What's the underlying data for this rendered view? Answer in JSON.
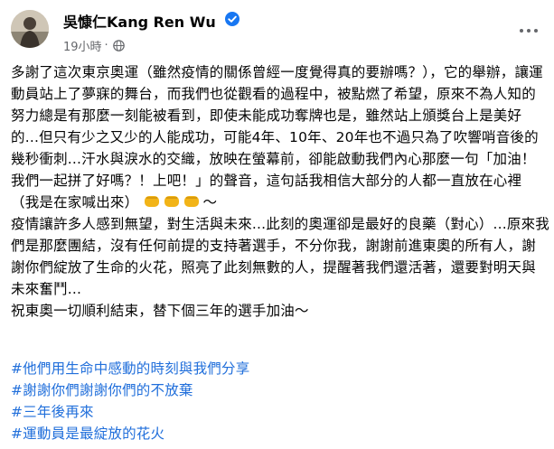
{
  "post": {
    "author": "吳慷仁Kang Ren Wu",
    "timestamp": "19小時",
    "separator": "·",
    "privacy_icon": "globe-icon",
    "verified_icon": "verified-badge-icon",
    "more_icon": "more-options-icon"
  },
  "content": {
    "p1": "多謝了這次東京奧運（雖然疫情的關係曾經一度覺得真的要辦嗎？），它的舉辦，讓運動員站上了夢寐的舞台，而我們也從觀看的過程中，被點燃了希望，原來不為人知的努力總是有那麼一刻能被看到，即使未能成功奪牌也是，雖然站上頒獎台上是美好的...但只有少之又少的人能成功，可能4年、10年、20年也不過只為了吹響哨音後的幾秒衝刺...汗水與淚水的交織，放映在螢幕前，卻能啟動我們內心那麼一句「加油！我們一起拼了好嗎？！上吧！」的聲音，這句話我相信大部分的人都一直放在心裡（我是在家喊出來）",
    "p1_tail": "～",
    "p1_emoji": "fist-emoji",
    "p2": "疫情讓許多人感到無望，對生活與未來...此刻的奧運卻是最好的良藥（對心）...原來我們是那麼團結，沒有任何前提的支持著選手，不分你我，謝謝前進東奧的所有人，謝謝你們綻放了生命的火花，照亮了此刻無數的人，提醒著我們還活著，還要對明天與未來奮鬥...",
    "p3": "祝東奧一切順利結束，替下個三年的選手加油～"
  },
  "hashtags": [
    "#他們用生命中感動的時刻與我們分享",
    "#謝謝你們謝謝你們的不放棄",
    "#三年後再來",
    "#運動員是最綻放的花火"
  ],
  "colors": {
    "link": "#216fdb",
    "secondary_text": "#65676b",
    "verified": "#1877f2",
    "text": "#050505"
  }
}
